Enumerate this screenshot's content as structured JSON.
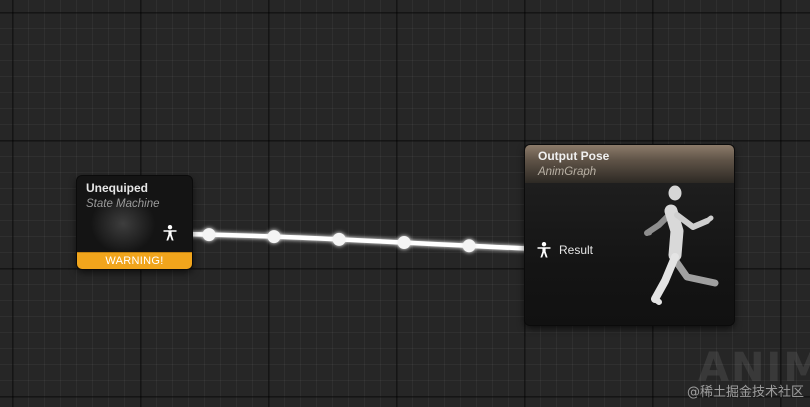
{
  "graph": {
    "background_color": "#262626",
    "wire_color": "#ffffff",
    "wire_reroute_points": 5
  },
  "nodes": {
    "state_machine": {
      "title": "Unequiped",
      "subtitle": "State Machine",
      "warning_label": "WARNING!",
      "warning_color": "#f1a51c",
      "output_pin_icon": "pose-icon"
    },
    "output_pose": {
      "title": "Output Pose",
      "subtitle": "AnimGraph",
      "input_pin_label": "Result",
      "input_pin_icon": "pose-icon",
      "preview_icon": "running-mannequin-icon",
      "header_color": "#8c7b6a"
    }
  },
  "watermarks": {
    "logo_text": "ANIM",
    "site_text": "@稀土掘金技术社区"
  }
}
